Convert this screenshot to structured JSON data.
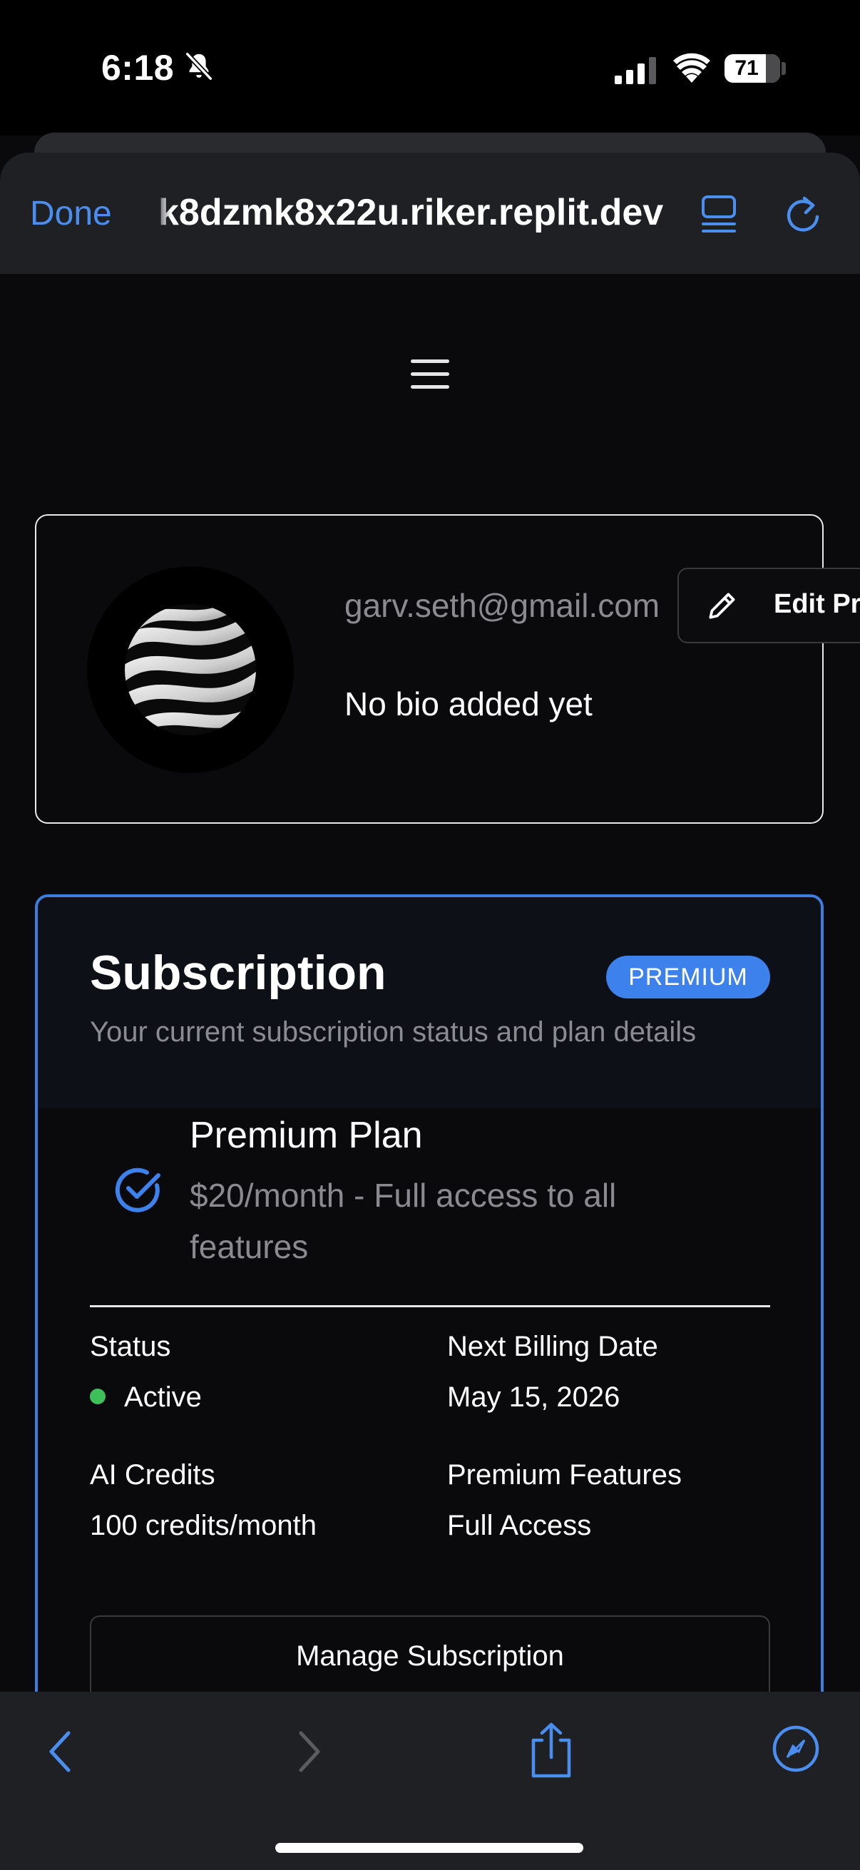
{
  "status_bar": {
    "time": "6:18",
    "battery": "71",
    "icons": [
      "bell-slash-icon",
      "cellular-signal-icon",
      "wifi-icon",
      "battery-icon"
    ]
  },
  "browser": {
    "done_label": "Done",
    "url": "k8dzmk8x22u.riker.replit.dev",
    "icons": [
      "reader-icon",
      "reload-icon"
    ],
    "accent": "#4a8ef0"
  },
  "nav": {
    "menu_icon": "hamburger-icon"
  },
  "profile": {
    "email": "garv.seth@gmail.com",
    "bio": "No bio added yet",
    "edit_label": "Edit Pro",
    "edit_icon": "pencil-icon"
  },
  "subscription": {
    "title": "Subscription",
    "badge": "PREMIUM",
    "description": "Your current subscription status and plan details",
    "plan_name": "Premium Plan",
    "plan_description": "$20/month - Full access to all features",
    "status_label": "Status",
    "status_value": "Active",
    "status_color": "#3fbf5a",
    "billing_label": "Next Billing Date",
    "billing_value": "May 15, 2026",
    "credits_label": "AI Credits",
    "credits_value": "100 credits/month",
    "features_label": "Premium Features",
    "features_value": "Full Access",
    "manage_label": "Manage Subscription",
    "border_color": "#3d7de0"
  },
  "toolbar": {
    "icons": [
      "back-icon",
      "forward-icon",
      "share-icon",
      "compass-icon"
    ]
  }
}
